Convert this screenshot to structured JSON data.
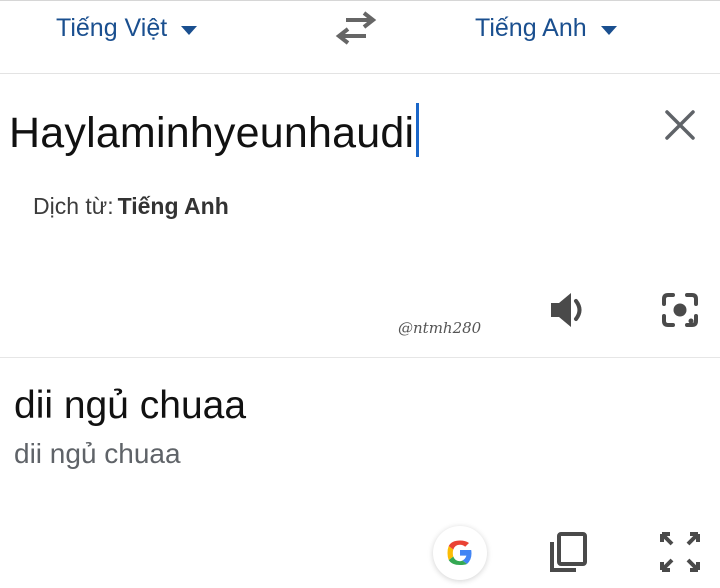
{
  "languages": {
    "source": "Tiếng Việt",
    "target": "Tiếng Anh"
  },
  "input": {
    "text": "Haylaminhyeunhaudi"
  },
  "detected": {
    "label": "Dịch từ:",
    "language": "Tiếng Anh"
  },
  "watermark": "@ntmh280",
  "output": {
    "translation": "dii ngủ chuaa",
    "romanization": "dii ngủ chuaa"
  },
  "icons": {
    "swap": "swap-arrows-icon",
    "clear": "close-icon",
    "speaker": "speaker-icon",
    "lens": "camera-lens-icon",
    "google": "google-g-icon",
    "copy": "copy-icon",
    "fullscreen": "fullscreen-icon"
  },
  "colors": {
    "accent": "#1a4f8f",
    "cursor": "#1a66c8"
  }
}
